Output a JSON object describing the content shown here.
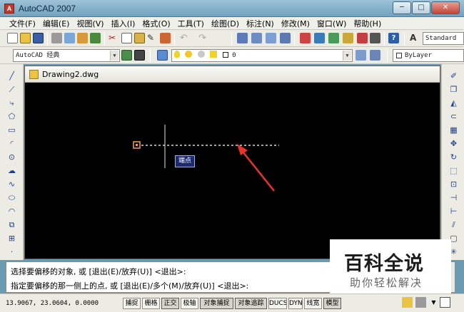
{
  "window": {
    "title": "AutoCAD 2007",
    "minimize": "─",
    "maximize": "□",
    "close": "✕"
  },
  "menu": [
    "文件(F)",
    "编辑(E)",
    "视图(V)",
    "插入(I)",
    "格式(O)",
    "工具(T)",
    "绘图(D)",
    "标注(N)",
    "修改(M)",
    "窗口(W)",
    "帮助(H)"
  ],
  "toolbar": {
    "text_style": "Standard",
    "workspace": "AutoCAD 经典",
    "layer": "0",
    "color": "ByLayer"
  },
  "drawing": {
    "tab_title": "Drawing2.dwg",
    "snap_tooltip": "端点"
  },
  "command": {
    "line1": "选择要偏移的对象, 或 [退出(E)/放弃(U)] <退出>:",
    "line2": "指定要偏移的那一侧上的点, 或 [退出(E)/多个(M)/放弃(U)] <退出>:"
  },
  "status": {
    "coords": "13.9067, 23.0604, 0.0000",
    "buttons": [
      {
        "label": "捕捉",
        "on": false
      },
      {
        "label": "栅格",
        "on": false
      },
      {
        "label": "正交",
        "on": true
      },
      {
        "label": "极轴",
        "on": false
      },
      {
        "label": "对象捕捉",
        "on": true
      },
      {
        "label": "对象追踪",
        "on": true
      },
      {
        "label": "DUCS",
        "on": false
      },
      {
        "label": "DYN",
        "on": false
      },
      {
        "label": "线宽",
        "on": false
      },
      {
        "label": "模型",
        "on": true
      }
    ]
  },
  "watermark": {
    "main": "百科全说",
    "sub": "助你轻松解决"
  },
  "colors": {
    "canvas_bg": "#000000",
    "snap_marker": "#f0a060",
    "arrow": "#e8332a",
    "tooltip_bg": "#1c2a6e"
  }
}
